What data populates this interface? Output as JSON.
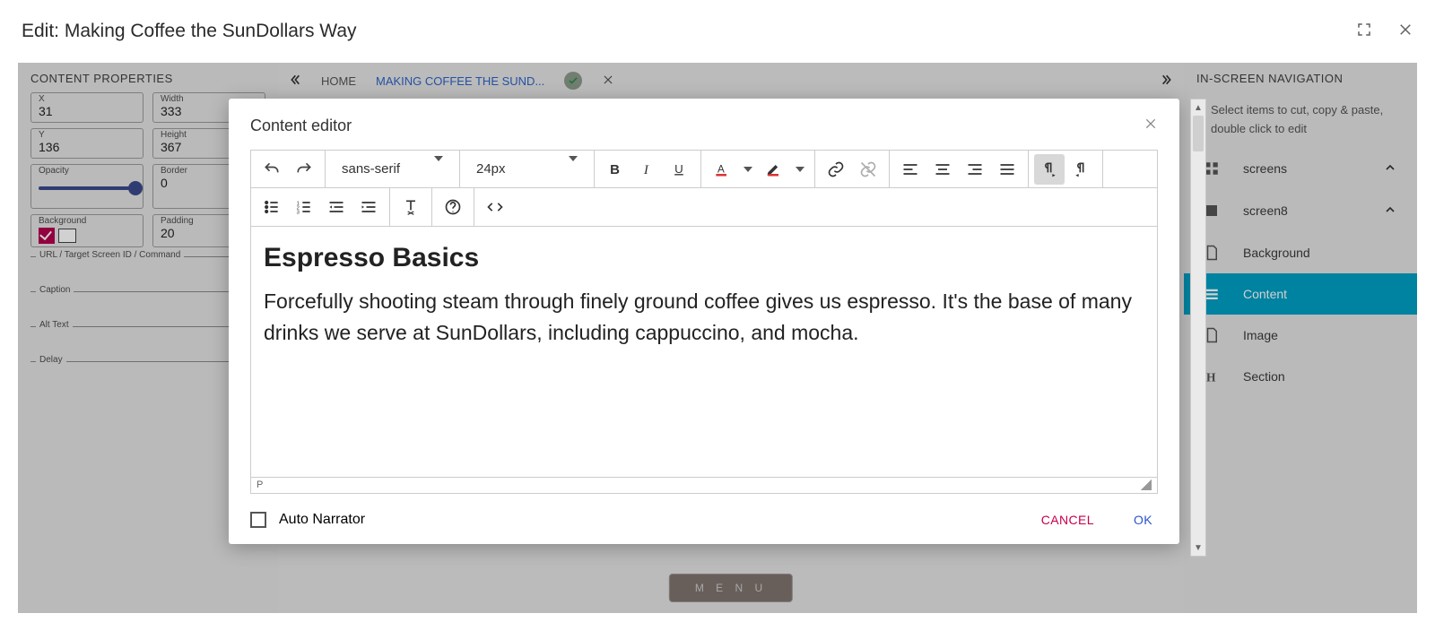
{
  "header": {
    "title": "Edit: Making Coffee the SunDollars Way"
  },
  "tabs": {
    "home": "HOME",
    "current": "MAKING COFFEE THE SUND..."
  },
  "left_panel": {
    "title": "CONTENT PROPERTIES",
    "x_label": "X",
    "x_value": "31",
    "width_label": "Width",
    "width_value": "333",
    "y_label": "Y",
    "y_value": "136",
    "height_label": "Height",
    "height_value": "367",
    "opacity_label": "Opacity",
    "border_label": "Border",
    "border_value": "0",
    "background_label": "Background",
    "padding_label": "Padding",
    "padding_value": "20",
    "url_label": "URL / Target Screen ID / Command",
    "caption_label": "Caption",
    "alt_label": "Alt Text",
    "delay_label": "Delay"
  },
  "right_panel": {
    "title": "IN-SCREEN NAVIGATION",
    "hint": "Select items to cut, copy & paste, double click to edit",
    "items": [
      {
        "label": "screens",
        "kind": "group",
        "expandable": true
      },
      {
        "label": "screen8",
        "kind": "screen",
        "expandable": true
      },
      {
        "label": "Background",
        "kind": "page"
      },
      {
        "label": "Content",
        "kind": "content",
        "selected": true
      },
      {
        "label": "Image",
        "kind": "page"
      },
      {
        "label": "Section",
        "kind": "heading"
      }
    ]
  },
  "modal": {
    "title": "Content editor",
    "font_family": "sans-serif",
    "font_size": "24px",
    "heading": "Espresso Basics",
    "paragraph": "Forcefully shooting steam through finely ground coffee gives us espresso. It's the base of many drinks we serve at SunDollars, including cappuccino, and mocha.",
    "status": "P",
    "auto_narrator": "Auto Narrator",
    "cancel": "CANCEL",
    "ok": "OK"
  },
  "menu_button": "M E N U"
}
